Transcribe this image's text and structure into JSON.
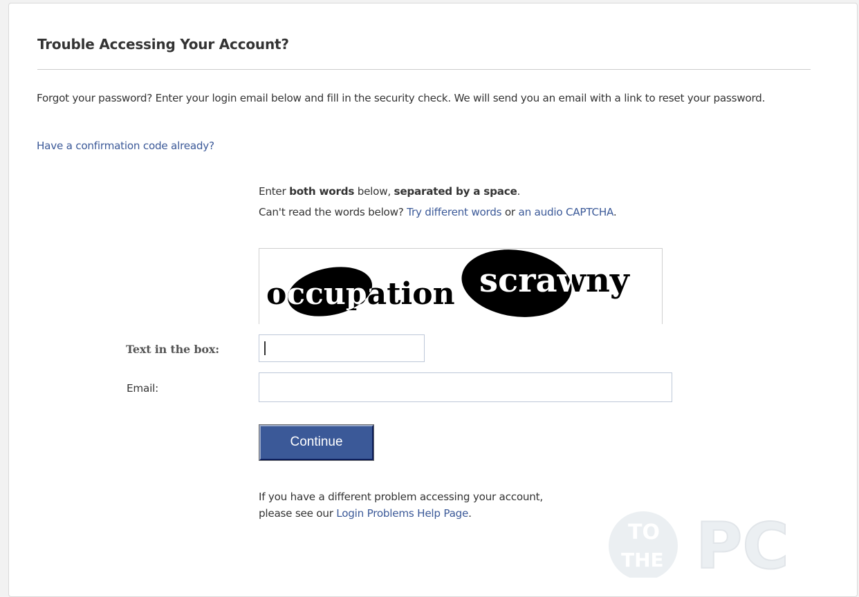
{
  "header": {
    "title": "Trouble Accessing Your Account?"
  },
  "intro": {
    "text": "Forgot your password? Enter your login email below and fill in the security check. We will send you an email with a link to reset your password.",
    "confirmation_link": "Have a confirmation code already?"
  },
  "captcha": {
    "instruction_enter": "Enter ",
    "instruction_both_words": "both words",
    "instruction_below": " below, ",
    "instruction_separated": "separated by a space",
    "instruction_period": ".",
    "cant_read": "Can't read the words below? ",
    "try_different": "Try different words",
    "or": " or ",
    "audio_captcha": "an audio CAPTCHA",
    "period2": ".",
    "word1": "occupation",
    "word2": "scrawny"
  },
  "form": {
    "text_in_box_label": "Text in the box:",
    "text_in_box_value": "",
    "email_label": "Email:",
    "email_value": "",
    "continue_label": "Continue"
  },
  "footer": {
    "line1": "If you have a different problem accessing your account,",
    "line2_prefix": "please see our ",
    "help_link": "Login Problems Help Page",
    "line2_suffix": "."
  },
  "watermark": {
    "text_to": "TO",
    "text_the": "THE",
    "text_pc": "PC"
  },
  "colors": {
    "link": "#3b5998",
    "button": "#3b5998",
    "text": "#333333"
  }
}
